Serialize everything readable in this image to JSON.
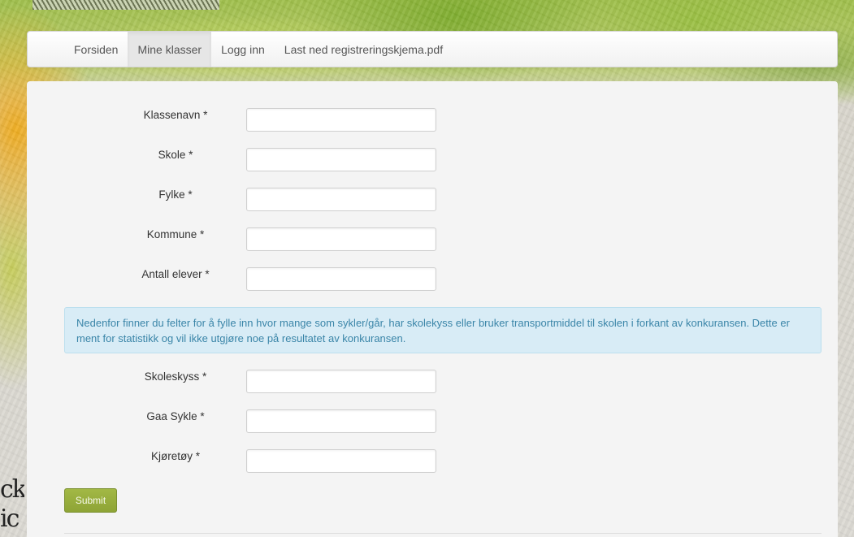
{
  "nav": {
    "items": [
      {
        "label": "Forsiden",
        "active": false
      },
      {
        "label": "Mine klasser",
        "active": true
      },
      {
        "label": "Logg inn",
        "active": false
      },
      {
        "label": "Last ned registreringskjema.pdf",
        "active": false
      }
    ]
  },
  "background": {
    "script_text": "ck ic"
  },
  "form": {
    "fields": [
      {
        "label": "Klassenavn *",
        "value": ""
      },
      {
        "label": "Skole *",
        "value": ""
      },
      {
        "label": "Fylke *",
        "value": ""
      },
      {
        "label": "Kommune *",
        "value": ""
      },
      {
        "label": "Antall elever *",
        "value": ""
      }
    ],
    "info_text": "Nedenfor finner du felter for å fylle inn hvor mange som sykler/går, har skolekyss eller bruker transportmiddel til skolen i forkant av konkuransen. Dette er ment for statistikk og vil ikke utgjøre noe på resultatet av konkuransen.",
    "transport_fields": [
      {
        "label": "Skoleskyss *",
        "value": ""
      },
      {
        "label": "Gaa Sykle *",
        "value": ""
      },
      {
        "label": "Kjøretøy *",
        "value": ""
      }
    ],
    "submit_label": "Submit"
  },
  "colors": {
    "accent_green": "#98ae3c",
    "info_bg": "#d8ecf6",
    "info_text": "#3a85a8"
  }
}
